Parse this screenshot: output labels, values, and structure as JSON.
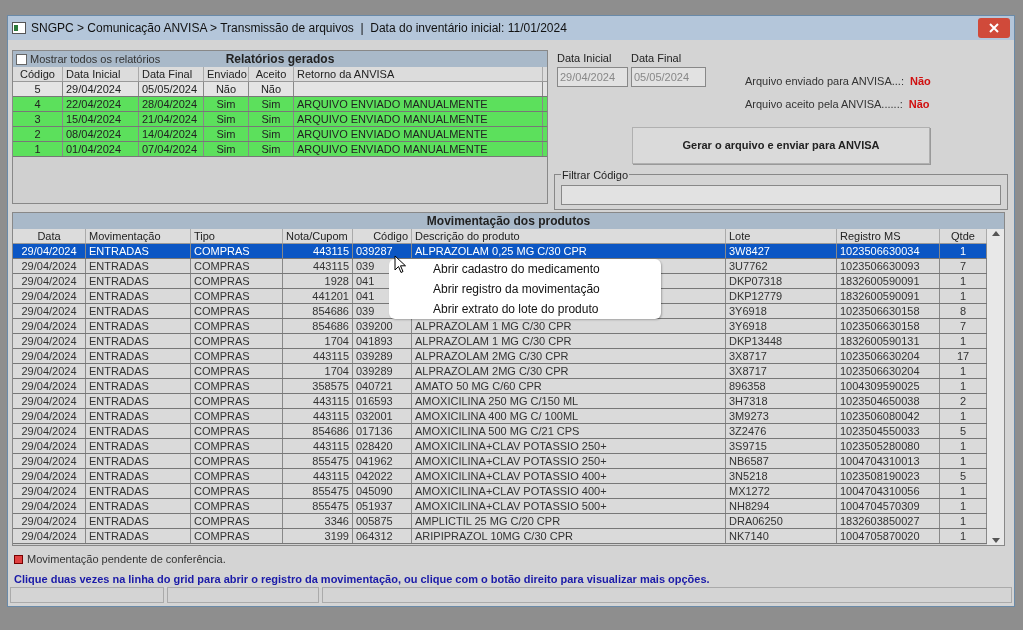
{
  "window": {
    "title": "SNGPC > Comunicação ANVISA > Transmissão de arquivos  |  Data do inventário inicial: 11/01/2024"
  },
  "reports": {
    "show_all": {
      "label": "Mostrar todos os relatórios",
      "checked": false
    },
    "title": "Relatórios gerados",
    "columns": [
      "Código",
      "Data Inicial",
      "Data Final",
      "Enviado",
      "Aceito",
      "Retorno da ANVISA"
    ],
    "rows": [
      {
        "cells": [
          "5",
          "29/04/2024",
          "05/05/2024",
          "Não",
          "Não"
        ],
        "color": "#e4e4e4"
      },
      {
        "cells": [
          "4",
          "22/04/2024",
          "28/04/2024",
          "Sim",
          "Sim",
          "ARQUIVO ENVIADO MANUALMENTE"
        ],
        "color": "#5ce05c"
      },
      {
        "cells": [
          "3",
          "15/04/2024",
          "21/04/2024",
          "Sim",
          "Sim",
          "ARQUIVO ENVIADO MANUALMENTE"
        ],
        "color": "#5ce05c"
      },
      {
        "cells": [
          "2",
          "08/04/2024",
          "14/04/2024",
          "Sim",
          "Sim",
          "ARQUIVO ENVIADO MANUALMENTE"
        ],
        "color": "#5ce05c"
      },
      {
        "cells": [
          "1",
          "01/04/2024",
          "07/04/2024",
          "Sim",
          "Sim",
          "ARQUIVO ENVIADO MANUALMENTE"
        ],
        "color": "#5ce05c"
      }
    ]
  },
  "period": {
    "start_label": "Data Inicial",
    "start": "29/04/2024",
    "end_label": "Data Final",
    "end": "05/05/2024"
  },
  "status": [
    {
      "label": "Arquivo enviado para ANVISA...:",
      "value": "Não"
    },
    {
      "label": "Arquivo aceito pela ANVISA......:",
      "value": "Não"
    }
  ],
  "send_button": "Gerar o arquivo e enviar para ANVISA",
  "filter": {
    "label": "Filtrar Código"
  },
  "movements": {
    "title": "Movimentação dos produtos",
    "columns": [
      "Data",
      "Movimentação",
      "Tipo",
      "Nota/Cupom",
      "Código",
      "Descrição do produto",
      "Lote",
      "Registro MS",
      "Qtde"
    ],
    "rows": [
      {
        "data": "29/04/2024",
        "mov": "ENTRADAS",
        "tipo": "COMPRAS",
        "nota": "443115",
        "codigo": "039287",
        "descricao": "ALPRAZOLAM 0,25 MG C/30 CPR",
        "lote": "3W8427",
        "registro": "1023506630034",
        "qtde": "1",
        "selected": true
      },
      {
        "data": "29/04/2024",
        "mov": "ENTRADAS",
        "tipo": "COMPRAS",
        "nota": "443115",
        "codigo": "039",
        "lote": "3U7762",
        "registro": "1023506630093",
        "qtde": "7",
        "selected": false
      },
      {
        "data": "29/04/2024",
        "mov": "ENTRADAS",
        "tipo": "COMPRAS",
        "nota": "1928",
        "codigo": "041",
        "lote": "DKP07318",
        "registro": "1832600590091",
        "qtde": "1",
        "selected": false
      },
      {
        "data": "29/04/2024",
        "mov": "ENTRADAS",
        "tipo": "COMPRAS",
        "nota": "441201",
        "codigo": "041",
        "lote": "DKP12779",
        "registro": "1832600590091",
        "qtde": "1",
        "selected": false
      },
      {
        "data": "29/04/2024",
        "mov": "ENTRADAS",
        "tipo": "COMPRAS",
        "nota": "854686",
        "codigo": "039",
        "lote": "3Y6918",
        "registro": "1023506630158",
        "qtde": "8",
        "selected": false
      },
      {
        "data": "29/04/2024",
        "mov": "ENTRADAS",
        "tipo": "COMPRAS",
        "nota": "854686",
        "codigo": "039200",
        "descricao": "ALPRAZOLAM 1 MG C/30 CPR",
        "lote": "3Y6918",
        "registro": "1023506630158",
        "qtde": "7",
        "selected": false
      },
      {
        "data": "29/04/2024",
        "mov": "ENTRADAS",
        "tipo": "COMPRAS",
        "nota": "1704",
        "codigo": "041893",
        "descricao": "ALPRAZOLAM 1 MG C/30 CPR",
        "lote": "DKP13448",
        "registro": "1832600590131",
        "qtde": "1",
        "selected": false
      },
      {
        "data": "29/04/2024",
        "mov": "ENTRADAS",
        "tipo": "COMPRAS",
        "nota": "443115",
        "codigo": "039289",
        "descricao": "ALPRAZOLAM 2MG C/30 CPR",
        "lote": "3X8717",
        "registro": "1023506630204",
        "qtde": "17",
        "selected": false
      },
      {
        "data": "29/04/2024",
        "mov": "ENTRADAS",
        "tipo": "COMPRAS",
        "nota": "1704",
        "codigo": "039289",
        "descricao": "ALPRAZOLAM 2MG C/30 CPR",
        "lote": "3X8717",
        "registro": "1023506630204",
        "qtde": "1",
        "selected": false
      },
      {
        "data": "29/04/2024",
        "mov": "ENTRADAS",
        "tipo": "COMPRAS",
        "nota": "358575",
        "codigo": "040721",
        "descricao": "AMATO 50 MG C/60 CPR",
        "lote": "896358",
        "registro": "1004309590025",
        "qtde": "1",
        "selected": false
      },
      {
        "data": "29/04/2024",
        "mov": "ENTRADAS",
        "tipo": "COMPRAS",
        "nota": "443115",
        "codigo": "016593",
        "descricao": "AMOXICILINA 250 MG C/150 ML",
        "lote": "3H7318",
        "registro": "1023504650038",
        "qtde": "2",
        "selected": false
      },
      {
        "data": "29/04/2024",
        "mov": "ENTRADAS",
        "tipo": "COMPRAS",
        "nota": "443115",
        "codigo": "032001",
        "descricao": "AMOXICILINA 400 MG C/ 100ML",
        "lote": "3M9273",
        "registro": "1023506080042",
        "qtde": "1",
        "selected": false
      },
      {
        "data": "29/04/2024",
        "mov": "ENTRADAS",
        "tipo": "COMPRAS",
        "nota": "854686",
        "codigo": "017136",
        "descricao": "AMOXICILINA 500 MG C/21 CPS",
        "lote": "3Z2476",
        "registro": "1023504550033",
        "qtde": "5",
        "selected": false
      },
      {
        "data": "29/04/2024",
        "mov": "ENTRADAS",
        "tipo": "COMPRAS",
        "nota": "443115",
        "codigo": "028420",
        "descricao": "AMOXICILINA+CLAV POTASSIO 250+",
        "lote": "3S9715",
        "registro": "1023505280080",
        "qtde": "1",
        "selected": false
      },
      {
        "data": "29/04/2024",
        "mov": "ENTRADAS",
        "tipo": "COMPRAS",
        "nota": "855475",
        "codigo": "041962",
        "descricao": "AMOXICILINA+CLAV POTASSIO 250+",
        "lote": "NB6587",
        "registro": "1004704310013",
        "qtde": "1",
        "selected": false
      },
      {
        "data": "29/04/2024",
        "mov": "ENTRADAS",
        "tipo": "COMPRAS",
        "nota": "443115",
        "codigo": "042022",
        "descricao": "AMOXICILINA+CLAV POTASSIO 400+",
        "lote": "3N5218",
        "registro": "1023508190023",
        "qtde": "5",
        "selected": false
      },
      {
        "data": "29/04/2024",
        "mov": "ENTRADAS",
        "tipo": "COMPRAS",
        "nota": "855475",
        "codigo": "045090",
        "descricao": "AMOXICILINA+CLAV POTASSIO 400+",
        "lote": "MX1272",
        "registro": "1004704310056",
        "qtde": "1",
        "selected": false
      },
      {
        "data": "29/04/2024",
        "mov": "ENTRADAS",
        "tipo": "COMPRAS",
        "nota": "855475",
        "codigo": "051937",
        "descricao": "AMOXICILINA+CLAV POTASSIO 500+",
        "lote": "NH8294",
        "registro": "1004704570309",
        "qtde": "1",
        "selected": false
      },
      {
        "data": "29/04/2024",
        "mov": "ENTRADAS",
        "tipo": "COMPRAS",
        "nota": "3346",
        "codigo": "005875",
        "descricao": "AMPLICTIL 25 MG C/20 CPR",
        "lote": "DRA06250",
        "registro": "1832603850027",
        "qtde": "1",
        "selected": false
      },
      {
        "data": "29/04/2024",
        "mov": "ENTRADAS",
        "tipo": "COMPRAS",
        "nota": "3199",
        "codigo": "064312",
        "descricao": "ARIPIPRAZOL 10MG C/30 CPR",
        "lote": "NK7140",
        "registro": "1004705870020",
        "qtde": "1",
        "selected": false
      }
    ]
  },
  "context_menu": {
    "items": [
      "Abrir cadastro do medicamento",
      "Abrir registro da movimentação",
      "Abrir extrato do lote do produto"
    ]
  },
  "legend": {
    "label": "Movimentação pendente de conferência.",
    "color": "#e04040"
  },
  "hint": "Clique duas vezes na linha do grid para abrir o registro da movimentação, ou clique com o botão direito para visualizar mais opções."
}
